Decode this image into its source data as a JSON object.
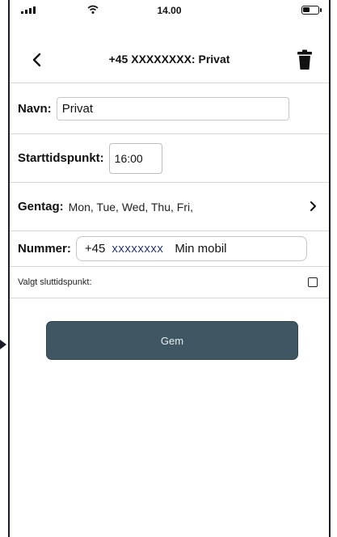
{
  "status_bar": {
    "time": "14.00"
  },
  "nav": {
    "title": "+45  XXXXXXXX: Privat",
    "back_icon": "chevron-left-icon",
    "delete_icon": "trash-icon"
  },
  "form": {
    "name": {
      "label": "Navn:",
      "value": "Privat"
    },
    "start_time": {
      "label": "Starttidspunkt:",
      "value": "16:00"
    },
    "repeat": {
      "label": "Gentag:",
      "value": "Mon, Tue, Wed, Thu, Fri,"
    },
    "number": {
      "label": "Nummer:",
      "prefix": "+45",
      "masked": "xxxxxxxx",
      "label2": "Min mobil"
    },
    "end_time": {
      "label": "Valgt sluttidspunkt:",
      "checked": false
    }
  },
  "save": {
    "label": "Gem"
  },
  "colors": {
    "button_bg": "#3f5762",
    "masked_text": "#2a3a7a"
  }
}
